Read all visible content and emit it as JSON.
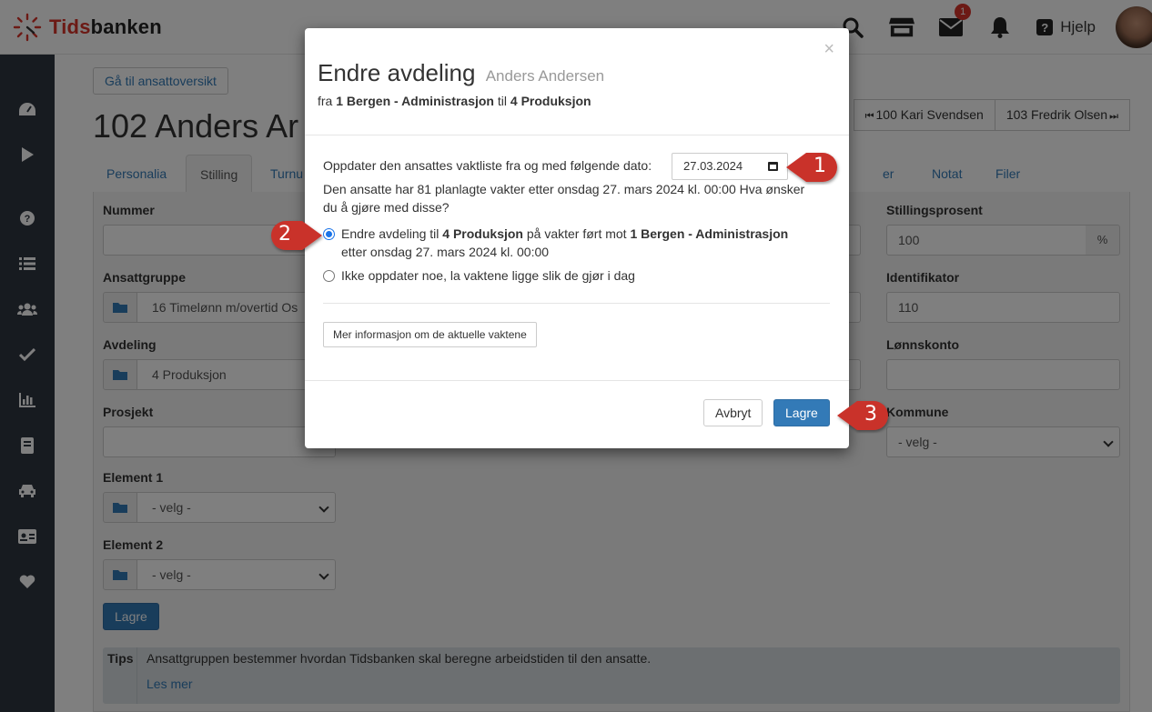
{
  "app": {
    "logo_text": "Tidsbanken",
    "logo_prefix": "Tids",
    "logo_suffix": "banken"
  },
  "topbar": {
    "messages_badge": "1",
    "help_label": "Hjelp",
    "icons": [
      "search-icon",
      "store-icon",
      "envelope-icon",
      "bell-icon",
      "question-icon"
    ]
  },
  "sidebar": {
    "icons": [
      "dashboard-icon",
      "play-icon",
      "question-circle-icon",
      "list-icon",
      "users-icon",
      "check-icon",
      "bar-chart-icon",
      "book-icon",
      "car-icon",
      "id-card-icon",
      "heart-icon"
    ]
  },
  "page": {
    "goto_button": "Gå til ansattoversikt",
    "title": "102 Anders Ar",
    "prev_employee": "100 Kari Svendsen",
    "next_employee": "103 Fredrik Olsen"
  },
  "tabs": [
    "Personalia",
    "Stilling",
    "Turnu",
    "er",
    "Notat",
    "Filer"
  ],
  "form": {
    "nummer_label": "Nummer",
    "ansattgruppe_label": "Ansattgruppe",
    "ansattgruppe_value": "16 Timelønn m/overtid Os",
    "avdeling_label": "Avdeling",
    "avdeling_value": "4 Produksjon",
    "prosjekt_label": "Prosjekt",
    "element1_label": "Element 1",
    "element1_value": "- velg -",
    "element2_label": "Element 2",
    "element2_value": "- velg -",
    "stillingsprosent_label": "Stillingsprosent",
    "stillingsprosent_value": "100",
    "percent_symbol": "%",
    "identifikator_label": "Identifikator",
    "identifikator_value": "110",
    "lonnskonto_label": "Lønnskonto",
    "kommune_label": "Kommune",
    "kommune_value": "- velg -",
    "save_button": "Lagre"
  },
  "tips": {
    "label": "Tips",
    "text": "Ansattgruppen bestemmer hvordan Tidsbanken skal beregne arbeidstiden til den ansatte.",
    "link": "Les mer"
  },
  "modal": {
    "close": "×",
    "title": "Endre avdeling",
    "employee": "Anders Andersen",
    "sub_from": "fra",
    "from_dept": "1 Bergen - Administrasjon",
    "sub_to": "til",
    "to_dept": "4 Produksjon",
    "date_prompt": "Oppdater den ansattes vaktliste fra og med følgende dato:",
    "date_value": "27.03.2024",
    "shifts_text_line1": "Den ansatte har 81 planlagte vakter etter onsdag 27. mars 2024 kl. 00:00 Hva ønsker",
    "shifts_text_line2": "du å gjøre med disse?",
    "option1_a": "Endre avdeling til",
    "option1_b": "4 Produksjon",
    "option1_c": "på vakter ført mot",
    "option1_d": "1 Bergen - Administrasjon",
    "option1_e": "etter onsdag 27. mars 2024 kl. 00:00",
    "option1_selected": true,
    "option2": "Ikke oppdater noe, la vaktene ligge slik de gjør i dag",
    "more_info": "Mer informasjon om de aktuelle vaktene",
    "cancel": "Avbryt",
    "save": "Lagre"
  },
  "callouts": [
    "1",
    "2",
    "3"
  ],
  "colors": {
    "brand_red": "#d9342b",
    "primary": "#337ab7",
    "sidebar": "#2f3640",
    "callout": "#c9302c"
  }
}
